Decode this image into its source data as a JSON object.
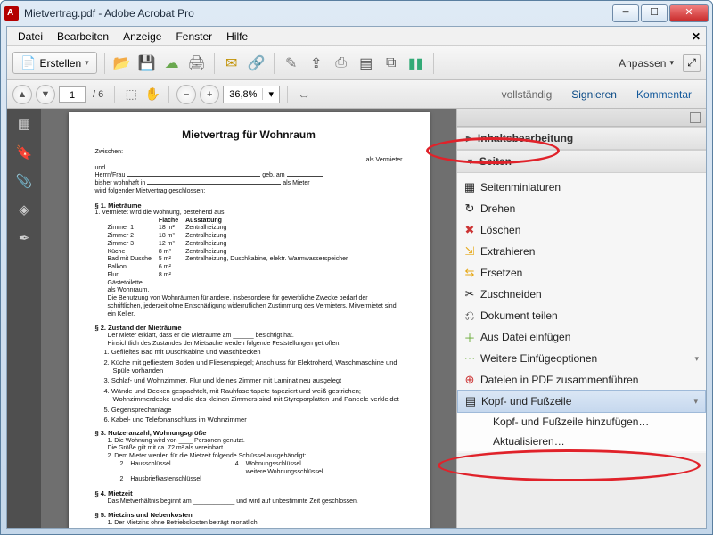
{
  "window": {
    "title": "Mietvertrag.pdf - Adobe Acrobat Pro"
  },
  "menu": {
    "datei": "Datei",
    "bearbeiten": "Bearbeiten",
    "anzeige": "Anzeige",
    "fenster": "Fenster",
    "hilfe": "Hilfe"
  },
  "toolbar1": {
    "erstellen": "Erstellen",
    "anpassen": "Anpassen"
  },
  "nav": {
    "page_current": "1",
    "page_total": "/ 6",
    "zoom": "36,8%"
  },
  "panel_tabs": {
    "vollstaendig": "vollständig",
    "signieren": "Signieren",
    "kommentar": "Kommentar"
  },
  "tools": {
    "inhaltsbearbeitung": "Inhaltsbearbeitung",
    "seiten": "Seiten",
    "items": {
      "seitenminiaturen": "Seitenminiaturen",
      "drehen": "Drehen",
      "loeschen": "Löschen",
      "extrahieren": "Extrahieren",
      "ersetzen": "Ersetzen",
      "zuschneiden": "Zuschneiden",
      "dokument_teilen": "Dokument teilen",
      "aus_datei": "Aus Datei einfügen",
      "weitere": "Weitere Einfügeoptionen",
      "zusammenfuehren": "Dateien in PDF zusammenführen",
      "kopf_fuss": "Kopf- und Fußzeile"
    },
    "submenu": {
      "hinzufuegen": "Kopf- und Fußzeile hinzufügen…",
      "aktualisieren": "Aktualisieren…"
    }
  },
  "doc": {
    "title": "Mietvertrag für Wohnraum",
    "zwischen": "Zwischen:",
    "als_vermieter": "als Vermieter",
    "und": "und",
    "herrn_frau": "Herrn/Frau",
    "geb_am": "geb. am",
    "bisher_wohnhaft": "bisher wohnhaft in",
    "als_mieter": "als Mieter",
    "wird_folgender": "wird folgender Mietvertrag geschlossen:",
    "s1_h": "§ 1.  Mieträume",
    "s1_1": "1.   Vermietet wird die Wohnung, bestehend aus:",
    "tbl_h_flaeche": "Fläche",
    "tbl_h_ausstattung": "Ausstattung",
    "rooms": [
      {
        "n": "Zimmer 1",
        "f": "18 m²",
        "a": "Zentralheizung"
      },
      {
        "n": "Zimmer 2",
        "f": "18 m²",
        "a": "Zentralheizung"
      },
      {
        "n": "Zimmer 3",
        "f": "12 m²",
        "a": "Zentralheizung"
      },
      {
        "n": "Küche",
        "f": "8 m²",
        "a": "Zentralheizung"
      },
      {
        "n": "Bad mit Dusche",
        "f": "5 m²",
        "a": "Zentralheizung, Duschkabine, elektr. Warmwasserspeicher"
      },
      {
        "n": "Balkon",
        "f": "6 m²",
        "a": ""
      },
      {
        "n": "Flur",
        "f": "8 m²",
        "a": ""
      },
      {
        "n": "Gästetoilette",
        "f": "",
        "a": ""
      }
    ],
    "als_wohnraum": "als Wohnraum.",
    "s1_note": "Die Benutzung von Wohnräumen für andere, insbesondere für gewerbliche Zwecke bedarf der schriftlichen, jederzeit ohne Entschädigung widerruflichen Zustimmung des Vermieters. Mitvermietet sind ein Keller.",
    "s2_h": "§ 2.  Zustand der Mieträume",
    "s2_intro": "Der Mieter erklärt, dass er die Mieträume am ______ besichtigt hat.\nHinsichtlich des Zustandes der Mietsache werden folgende Feststellungen getroffen:",
    "s2_list": [
      "1.  Geflieſtes Bad mit Duschkabine und Waschbecken",
      "2.  Küche mit gefliestem Boden und Fliesenspiegel; Anschluss für Elektroherd, Waschmaschine und Spüle vorhanden",
      "3.  Schlaf- und Wohnzimmer, Flur und kleines Zimmer mit Laminat neu ausgelegt",
      "4.  Wände und Decken gespachtelt, mit Rauhfasertapete tapeziert und weiß gestrichen; Wohnzimmerdecke und die des kleinen Zimmers sind mit Styroporplatten und Paneele verkleidet",
      "5.  Gegensprechanlage",
      "6.  Kabel- und Telefonanschluss im Wohnzimmer"
    ],
    "s3_h": "§ 3.  Nutzeranzahl, Wohnungsgröße",
    "s3_1": "1.  Die Wohnung wird von ____ Personen genutzt.\n    Die Größe gilt mit ca. 72 m² als vereinbart.",
    "s3_2": "2.  Dem Mieter werden für die Mietzeit folgende Schlüssel ausgehändigt:",
    "keys": [
      {
        "n": "2",
        "t": "Hausschlüssel"
      },
      {
        "n": "4",
        "t": "Wohnungsschlüssel"
      },
      {
        "n": "",
        "t": ""
      },
      {
        "n": "",
        "t": "weitere Wohnungsschlüssel"
      },
      {
        "n": "2",
        "t": "Hausbriefkastenschlüssel"
      }
    ],
    "s4_h": "§ 4.  Mietzeit",
    "s4_1": "Das Mietverhältnis beginnt am ____________ und wird auf unbestimmte Zeit geschlossen.",
    "s5_h": "§ 5.  Mietzins und Nebenkosten",
    "s5_1": "1.  Der Mietzins ohne Betriebskosten beträgt monatlich"
  }
}
